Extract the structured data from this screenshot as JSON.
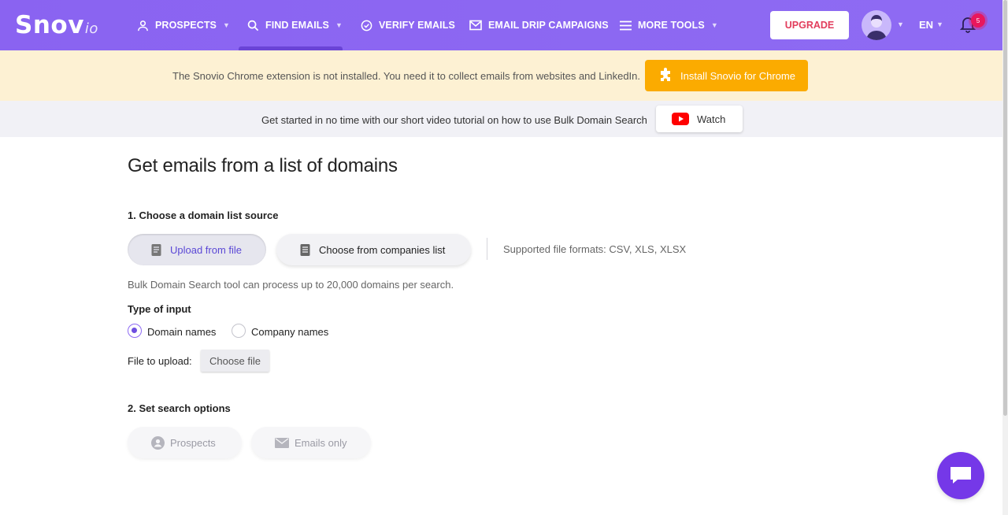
{
  "header": {
    "logo_main": "Snov",
    "logo_suffix": "io",
    "nav": [
      {
        "label": "PROSPECTS",
        "icon": "person-icon",
        "has_dropdown": true
      },
      {
        "label": "FIND EMAILS",
        "icon": "search-icon",
        "has_dropdown": true,
        "active": true
      },
      {
        "label": "VERIFY EMAILS",
        "icon": "check-circle-icon",
        "has_dropdown": false
      },
      {
        "label": "EMAIL DRIP CAMPAIGNS",
        "icon": "envelope-icon",
        "has_dropdown": false
      },
      {
        "label": "MORE TOOLS",
        "icon": "menu-icon",
        "has_dropdown": true
      }
    ],
    "upgrade_label": "UPGRADE",
    "language": "EN",
    "notification_count": "5"
  },
  "extension_banner": {
    "message": "The Snovio Chrome extension is not installed. You need it to collect emails from websites and LinkedIn.",
    "button_label": "Install Snovio for Chrome"
  },
  "tutorial_bar": {
    "message": "Get started in no time with our short video tutorial on how to use Bulk Domain Search",
    "button_label": "Watch"
  },
  "main": {
    "title": "Get emails from a list of domains",
    "step1_title": "1. Choose a domain list source",
    "source_options": [
      {
        "label": "Upload from file",
        "selected": true
      },
      {
        "label": "Choose from companies list",
        "selected": false
      }
    ],
    "formats_text": "Supported file formats: CSV, XLS, XLSX",
    "limit_text": "Bulk Domain Search tool can process up to 20,000 domains per search.",
    "input_type_label": "Type of input",
    "input_types": [
      {
        "label": "Domain names",
        "checked": true
      },
      {
        "label": "Company names",
        "checked": false
      }
    ],
    "file_label": "File to upload:",
    "choose_file_label": "Choose file",
    "step2_title": "2. Set search options",
    "search_options": [
      {
        "label": "Prospects",
        "enabled": false
      },
      {
        "label": "Emails only",
        "enabled": false
      }
    ]
  },
  "colors": {
    "header_bg": "#8b67f2",
    "upgrade_text": "#e23d5c",
    "banner_bg": "#fdf1d3",
    "install_btn": "#fbab00",
    "accent": "#5b48d6",
    "chat_btn": "#7538e8"
  }
}
